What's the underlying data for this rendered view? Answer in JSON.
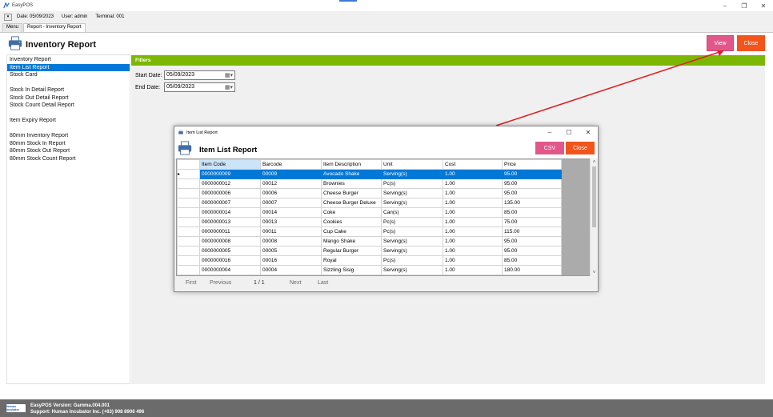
{
  "window": {
    "title": "EasyPOS"
  },
  "infobar": {
    "date": "Date: 05/09/2023",
    "user": "User: admin",
    "terminal": "Terminal: 001"
  },
  "tabs": [
    {
      "label": "Menu"
    },
    {
      "label": "Report - Inventory Report"
    }
  ],
  "page": {
    "title": "Inventory Report",
    "view_label": "View",
    "close_label": "Close"
  },
  "sidebar": {
    "items": [
      {
        "label": "Inventory Report"
      },
      {
        "label": "Item List Report",
        "selected": true
      },
      {
        "label": "Stock Card"
      },
      {
        "label": "Stock In Detail Report"
      },
      {
        "label": "Stock Out Detail Report"
      },
      {
        "label": "Stock Count Detail Report"
      },
      {
        "label": "Item Expiry Report"
      },
      {
        "label": "80mm Inventory Report"
      },
      {
        "label": "80mm Stock In Report"
      },
      {
        "label": "80mm Stock Out Report"
      },
      {
        "label": "80mm Stock Count Report"
      }
    ]
  },
  "filters": {
    "heading": "Filters",
    "start_label": "Start Date:",
    "start_value": "05/09/2023",
    "end_label": "End Date:",
    "end_value": "05/09/2023"
  },
  "modal": {
    "window_title": "Item List Report",
    "title": "Item List Report",
    "csv_label": "CSV",
    "close_label": "Close",
    "columns": [
      "Item Code",
      "Barcode",
      "Item Description",
      "Unit",
      "Cost",
      "Price"
    ],
    "rows": [
      [
        "0000000009",
        "00009",
        "Avocado Shake",
        "Serving(s)",
        "1.00",
        "95.00"
      ],
      [
        "0000000012",
        "00012",
        "Brownies",
        "Pc(s)",
        "1.00",
        "95.00"
      ],
      [
        "0000000006",
        "00006",
        "Cheese Burger",
        "Serving(s)",
        "1.00",
        "95.00"
      ],
      [
        "0000000007",
        "00007",
        "Cheese Burger Deluxe",
        "Serving(s)",
        "1.00",
        "135.00"
      ],
      [
        "0000000014",
        "00014",
        "Coke",
        "Can(s)",
        "1.00",
        "85.00"
      ],
      [
        "0000000013",
        "00013",
        "Cookies",
        "Pc(s)",
        "1.00",
        "75.00"
      ],
      [
        "0000000011",
        "00011",
        "Cup Cake",
        "Pc(s)",
        "1.00",
        "115.00"
      ],
      [
        "0000000008",
        "00008",
        "Mango Shake",
        "Serving(s)",
        "1.00",
        "95.00"
      ],
      [
        "0000000005",
        "00005",
        "Regular Burger",
        "Serving(s)",
        "1.00",
        "95.00"
      ],
      [
        "0000000016",
        "00016",
        "Royal",
        "Pc(s)",
        "1.00",
        "85.00"
      ],
      [
        "0000000004",
        "00004",
        "Sizzling  Sisig",
        "Serving(s)",
        "1.00",
        "180.00"
      ]
    ],
    "pager": {
      "first": "First",
      "previous": "Previous",
      "page": "1 / 1",
      "next": "Next",
      "last": "Last"
    }
  },
  "status": {
    "logo_text": "Human Incubator",
    "version": "EasyPOS Version: Gamma.004.001",
    "support": "Support: Human Incubator Inc. (+63) 908 8906 496"
  },
  "colors": {
    "accent_green": "#7bb700",
    "view_pink": "#e2578a",
    "close_orange": "#f2541b",
    "selection_blue": "#0078d7",
    "arrow_red": "#e02020"
  }
}
